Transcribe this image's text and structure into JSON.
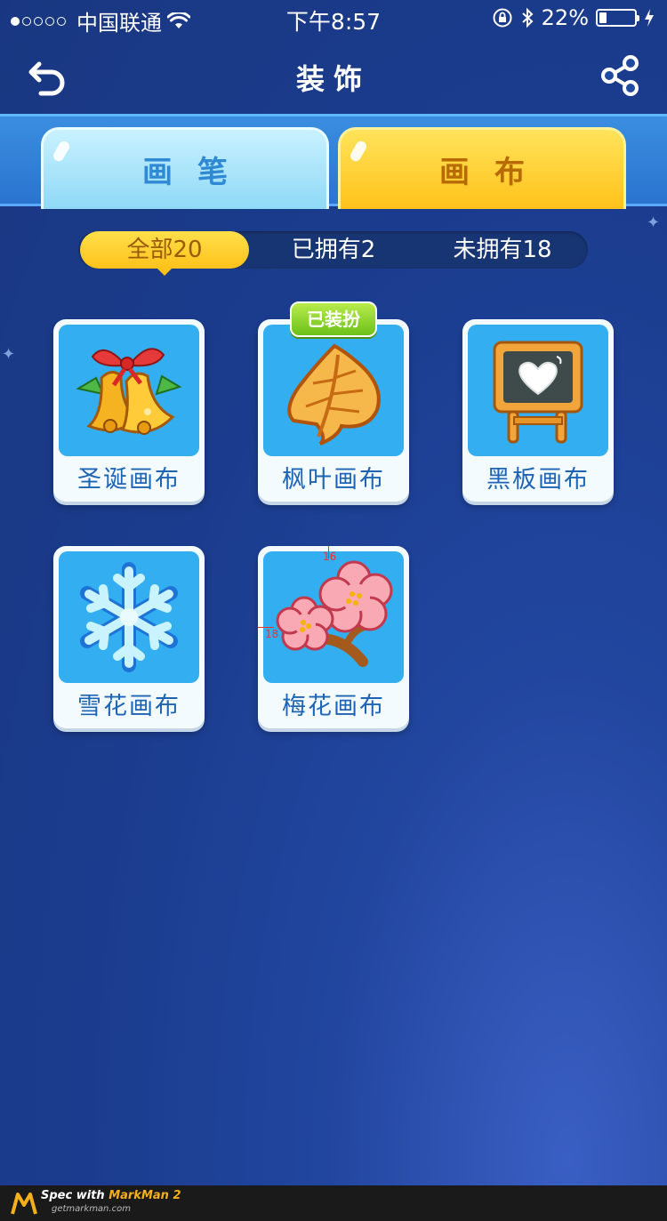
{
  "status_bar": {
    "carrier": "中国联通",
    "time": "下午8:57",
    "battery": "22%",
    "battery_level": 0.22,
    "signal_dots_filled": 1,
    "signal_dots_total": 5
  },
  "nav": {
    "title": "装饰",
    "back_icon": "back-arrow-icon",
    "share_icon": "share-icon"
  },
  "tabs": [
    {
      "label": "画笔",
      "active": false
    },
    {
      "label": "画布",
      "active": true
    }
  ],
  "filter": {
    "options": [
      {
        "label": "全部20",
        "active": true
      },
      {
        "label": "已拥有2",
        "active": false
      },
      {
        "label": "未拥有18",
        "active": false
      }
    ]
  },
  "items": [
    {
      "name": "圣诞画布",
      "icon": "christmas-bells-icon"
    },
    {
      "name": "枫叶画布",
      "icon": "maple-leaf-icon",
      "badge": "已装扮"
    },
    {
      "name": "黑板画布",
      "icon": "chalkboard-icon"
    },
    {
      "name": "雪花画布",
      "icon": "snowflake-icon"
    },
    {
      "name": "梅花画布",
      "icon": "plum-blossom-icon"
    }
  ],
  "spec_marks": {
    "top": "16",
    "left": "18"
  },
  "footer": {
    "brand_prefix": "Spec with ",
    "brand_name": "MarkMan 2",
    "url": "getmarkman.com"
  },
  "colors": {
    "background": "#1b3c8e",
    "active_yellow": "#ffc21b",
    "card_label": "#1e64b5"
  }
}
